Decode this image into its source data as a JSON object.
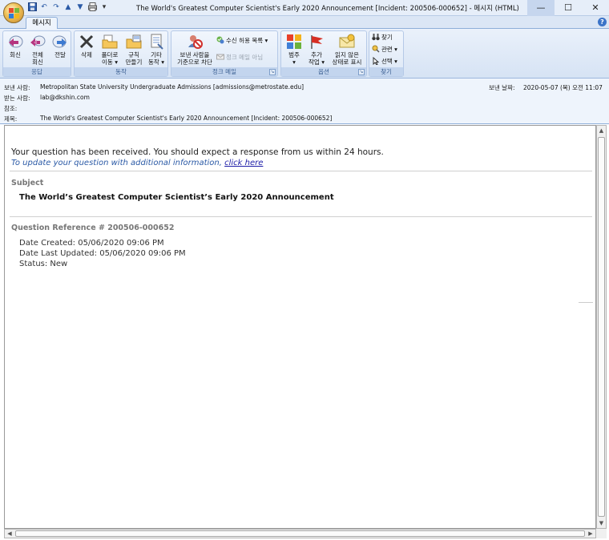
{
  "window": {
    "title": "The World's Greatest Computer Scientist's Early 2020 Announcement [Incident: 200506-000652] - 메시지 (HTML)",
    "controls": {
      "minimize": "—",
      "maximize": "☐",
      "close": "✕"
    }
  },
  "quick_access": [
    "save-icon",
    "undo-icon",
    "redo-icon",
    "up-icon",
    "down-icon",
    "print-icon",
    "dropdown-icon"
  ],
  "tabs": {
    "message": "메시지"
  },
  "ribbon": {
    "respond": {
      "label": "응답",
      "reply": "회신",
      "reply_all_1": "전체",
      "reply_all_2": "회신",
      "forward": "전달"
    },
    "actions": {
      "label": "동작",
      "delete": "삭제",
      "move_1": "폴더로",
      "move_2": "이동 ▾",
      "rules_1": "규칙",
      "rules_2": "만들기",
      "other_1": "기타",
      "other_2": "동작 ▾"
    },
    "junk": {
      "label": "정크 메일",
      "block_1": "보낸 사람을",
      "block_2": "기준으로 차단",
      "safe_list": "수신 허용 목록 ▾",
      "not_junk": "정크 메일 아님"
    },
    "options": {
      "label": "옵션",
      "categorize_1": "범주",
      "categorize_2": "▾",
      "followup_1": "추가",
      "followup_2": "작업 ▾",
      "unread_1": "읽지 않은",
      "unread_2": "상태로 표시"
    },
    "find": {
      "label": "찾기",
      "find": "찾기",
      "related": "관련 ▾",
      "select": "선택 ▾"
    }
  },
  "header": {
    "from_label": "보낸 사람:",
    "from_value": "Metropolitan State University Undergraduate Admissions [admissions@metrostate.edu]",
    "to_label": "받는 사람:",
    "to_value": "lab@dkshin.com",
    "cc_label": "참조:",
    "cc_value": "",
    "subject_label": "제목:",
    "subject_value": "The World's Greatest Computer Scientist's Early 2020 Announcement [Incident: 200506-000652]",
    "sent_label": "보낸 날짜:",
    "sent_value": "2020-05-07 (목) 오전 11:07"
  },
  "body": {
    "received_text": "Your question has been received. You should expect a response from us within 24 hours.",
    "update_prefix": "To update your question with additional information, ",
    "update_link": "click here",
    "subject_heading": "Subject",
    "subject_text": "The World’s Greatest Computer Scientist’s Early 2020 Announcement",
    "reference_heading": "Question Reference # 200506-000652",
    "date_created": "Date Created: 05/06/2020 09:06 PM",
    "date_updated": "Date Last Updated: 05/06/2020 09:06 PM",
    "status": "Status: New"
  },
  "colors": {
    "accent": "#2b5aa6",
    "ribbon_bg": "#dbe6f5",
    "link": "#1a1aa6"
  }
}
